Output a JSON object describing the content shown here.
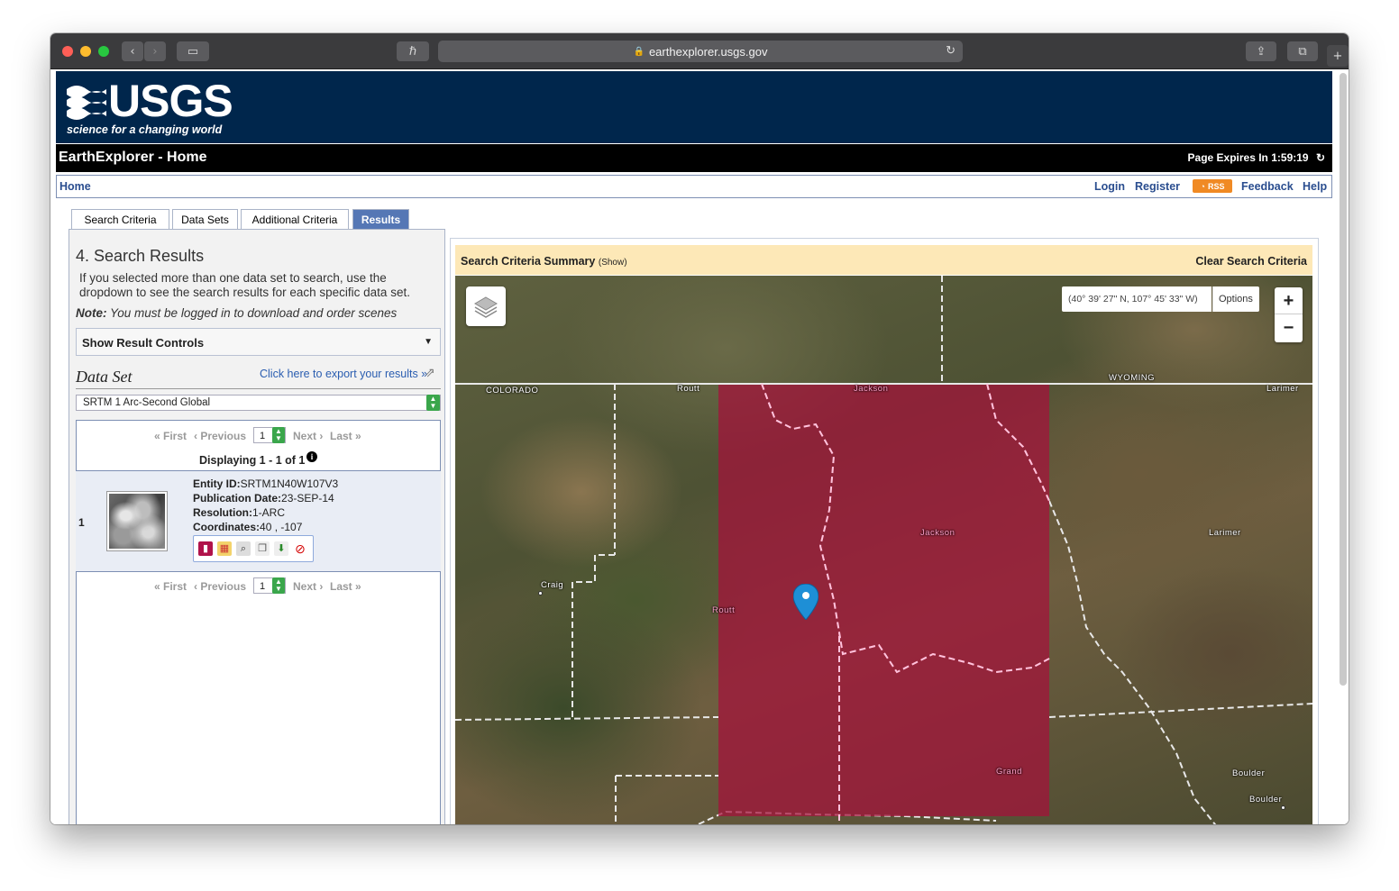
{
  "browser": {
    "url": "earthexplorer.usgs.gov"
  },
  "header": {
    "logo_word": "USGS",
    "logo_tagline": "science for a changing world"
  },
  "titlebar": {
    "title": "EarthExplorer - Home",
    "expires": "Page Expires In 1:59:19"
  },
  "nav": {
    "home": "Home",
    "login": "Login",
    "register": "Register",
    "rss": "RSS",
    "feedback": "Feedback",
    "help": "Help"
  },
  "tabs": [
    {
      "label": "Search Criteria",
      "active": false
    },
    {
      "label": "Data Sets",
      "active": false
    },
    {
      "label": "Additional Criteria",
      "active": false
    },
    {
      "label": "Results",
      "active": true
    }
  ],
  "results_panel": {
    "title": "4. Search Results",
    "description": "If you selected more than one data set to search, use the dropdown to see the search results for each specific data set.",
    "note_label": "Note:",
    "note_text": "You must be logged in to download and order scenes",
    "result_controls": "Show Result Controls",
    "dataset_label": "Data Set",
    "export_link": "Click here to export your results »",
    "dataset_selected": "SRTM 1 Arc-Second Global",
    "pager": {
      "first": "« First",
      "previous": "‹ Previous",
      "page": "1",
      "next": "Next ›",
      "last": "Last »"
    },
    "displaying": "Displaying 1 - 1 of 1",
    "result": {
      "index": "1",
      "entity_label": "Entity ID:",
      "entity_value": "SRTM1N40W107V3",
      "pubdate_label": "Publication Date:",
      "pubdate_value": "23-SEP-14",
      "resolution_label": "Resolution:",
      "resolution_value": "1-ARC",
      "coords_label": "Coordinates:",
      "coords_value": "40 , -107"
    }
  },
  "map": {
    "summary_title": "Search Criteria Summary",
    "summary_show": "(Show)",
    "clear": "Clear Search Criteria",
    "coordinates": "(40° 39' 27\" N, 107° 45' 33\" W)",
    "options": "Options",
    "zoom_in": "+",
    "zoom_out": "−",
    "labels": {
      "colorado": "COLORADO",
      "wyoming": "WYOMING",
      "routt_top": "Routt",
      "jackson_top": "Jackson",
      "larimer_top": "Larimer",
      "jackson_mid": "Jackson",
      "larimer_mid": "Larimer",
      "craig": "Craig",
      "routt_mid": "Routt",
      "grand": "Grand",
      "boulder_county": "Boulder",
      "boulder_city": "Boulder"
    },
    "highlight_color": "#a5103a"
  }
}
